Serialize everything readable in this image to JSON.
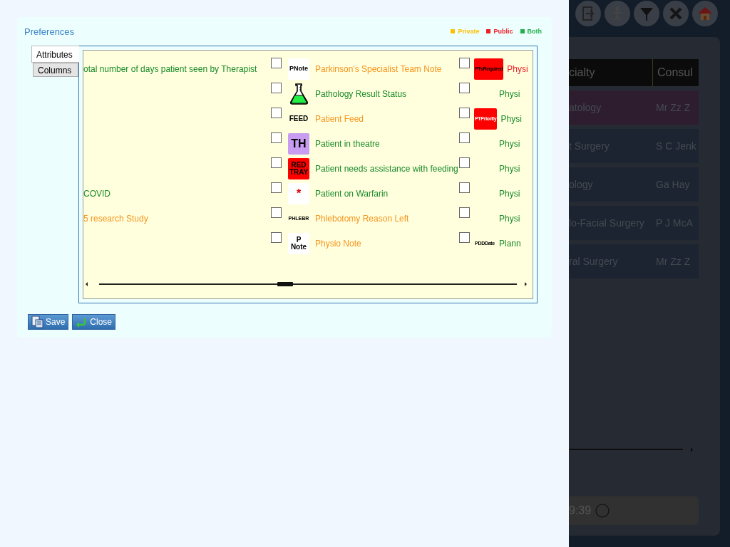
{
  "dialog": {
    "title": "Preferences",
    "legend": [
      {
        "label": "Private",
        "color": "#ffc000"
      },
      {
        "label": "Public",
        "color": "#ee1c24"
      },
      {
        "label": "Both",
        "color": "#22b04c"
      }
    ],
    "tabs": [
      {
        "label": "Attributes",
        "selected": true
      },
      {
        "label": "Columns",
        "selected": false
      }
    ],
    "columns": [
      {
        "items": [
          {
            "kind": "text",
            "label": "otal number of days patient seen by Therapist",
            "color": "#1a8a2a"
          },
          {
            "kind": "blank"
          },
          {
            "kind": "blank"
          },
          {
            "kind": "blank"
          },
          {
            "kind": "blank"
          },
          {
            "kind": "text",
            "label": "COVID",
            "color": "#1a8a2a"
          },
          {
            "kind": "text",
            "label": "5 research Study",
            "color": "#f7941d"
          },
          {
            "kind": "blank"
          }
        ]
      },
      {
        "items": [
          {
            "kind": "option",
            "checked": false,
            "icon": {
              "kind": "badge",
              "lines": [
                "PNote"
              ],
              "color": "#ffffff"
            },
            "label": "Parkinson's Specialist Team Note",
            "color": "#f7941d"
          },
          {
            "kind": "option",
            "checked": false,
            "icon": {
              "kind": "flask"
            },
            "label": "Pathology Result Status",
            "color": "#1a8a2a"
          },
          {
            "kind": "option",
            "checked": false,
            "icon": {
              "kind": "badge",
              "lines": [
                "FEED"
              ]
            },
            "label": "Patient Feed",
            "color": "#f7941d"
          },
          {
            "kind": "option",
            "checked": false,
            "icon": {
              "kind": "badge",
              "lines": [
                "TH"
              ],
              "color": "#c89cf0"
            },
            "label": "Patient in theatre",
            "color": "#1a8a2a"
          },
          {
            "kind": "option",
            "checked": false,
            "icon": {
              "kind": "badge",
              "lines": [
                "RED",
                "TRAY"
              ],
              "color": "#ff0000"
            },
            "label": "Patient needs assistance with feeding",
            "color": "#1a8a2a"
          },
          {
            "kind": "option",
            "checked": false,
            "icon": {
              "kind": "badge-red-text",
              "lines": [
                "*"
              ],
              "color": "#ffffff"
            },
            "label": "Patient on Warfarin",
            "color": "#1a8a2a"
          },
          {
            "kind": "option",
            "checked": false,
            "icon": {
              "kind": "badge",
              "lines": [
                "PHLEBR"
              ]
            },
            "label": "Phlebotomy Reason Left",
            "color": "#f7941d"
          },
          {
            "kind": "option",
            "checked": false,
            "icon": {
              "kind": "badge",
              "lines": [
                "P",
                "Note"
              ],
              "color": "#ffffff"
            },
            "label": "Physio Note",
            "color": "#f7941d"
          }
        ]
      },
      {
        "items": [
          {
            "kind": "option",
            "checked": false,
            "icon": {
              "kind": "badge",
              "lines": [
                "PTsRequired"
              ],
              "color": "#ff0000"
            },
            "label": "Physi",
            "color": "#ee1c24"
          },
          {
            "kind": "option",
            "checked": false,
            "label": "Physi",
            "color": "#1a8a2a"
          },
          {
            "kind": "option",
            "checked": false,
            "icon": {
              "kind": "badge-white-text",
              "lines": [
                "PTPriority"
              ],
              "color": "#ff0000"
            },
            "label": "Physi",
            "color": "#1a8a2a"
          },
          {
            "kind": "option",
            "checked": false,
            "label": "Physi",
            "color": "#1a8a2a"
          },
          {
            "kind": "option",
            "checked": false,
            "label": "Physi",
            "color": "#1a8a2a"
          },
          {
            "kind": "option",
            "checked": false,
            "label": "Physi",
            "color": "#1a8a2a"
          },
          {
            "kind": "option",
            "checked": false,
            "label": "Physi",
            "color": "#1a8a2a"
          },
          {
            "kind": "option",
            "checked": false,
            "icon": {
              "kind": "badge",
              "lines": [
                "PDDDate"
              ]
            },
            "label": "Plann",
            "color": "#1a8a2a"
          }
        ]
      }
    ],
    "buttons": [
      {
        "kind": "save",
        "label": "Save"
      },
      {
        "kind": "close",
        "label": "Close"
      }
    ]
  },
  "background_app": {
    "table": {
      "columns": [
        "cialty",
        "Consul"
      ],
      "rows": [
        {
          "cells": [
            "atology",
            "Mr Zz Z"
          ],
          "selected": true
        },
        {
          "cells": [
            "t Surgery",
            "S C Jenk"
          ],
          "selected": false
        },
        {
          "cells": [
            "ology",
            "Ga Hay"
          ],
          "selected": false
        },
        {
          "cells": [
            "lo-Facial Surgery",
            "P J McA"
          ],
          "selected": false
        },
        {
          "cells": [
            "ral Surgery",
            "Mr Zz Z"
          ],
          "selected": false
        }
      ]
    },
    "status_bar": {
      "time": "9:39"
    }
  }
}
